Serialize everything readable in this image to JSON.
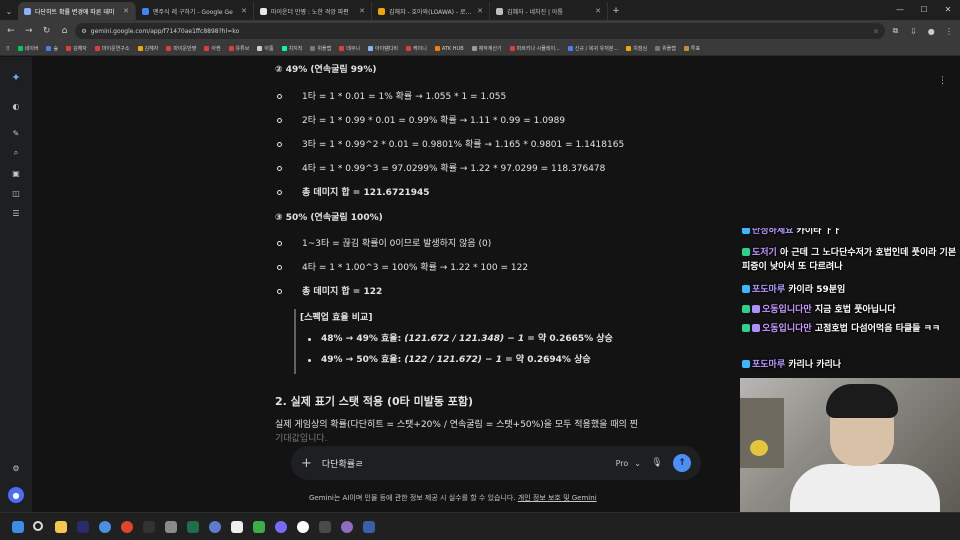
{
  "browser": {
    "tabs": [
      {
        "title": "다단히트 확률 변경에 따른 데미",
        "active": true,
        "color": "#8ab4f8"
      },
      {
        "title": "맨주식 레 구하기 - Google Ge",
        "active": false,
        "color": "#4285f4"
      },
      {
        "title": "마이운더 만쨩 : 노한 격앙 파편",
        "active": false,
        "color": "#e8e8e8"
      },
      {
        "title": "김해쟈 - 호아와(LOAWA) - 로...",
        "active": false,
        "color": "#f2a600"
      },
      {
        "title": "김혜자 - 네차진 | 아툼",
        "active": false,
        "color": "#bfbfbf"
      }
    ],
    "url": "gemini.google.com/app/f71470ae1ffc8898?hl=ko",
    "bookmarks": [
      {
        "label": "네이버",
        "color": "#03c75a"
      },
      {
        "label": "숲",
        "color": "#4a7df5"
      },
      {
        "label": "김해자",
        "color": "#e03c3c"
      },
      {
        "label": "마이운연구소",
        "color": "#e03c3c"
      },
      {
        "label": "김혜자",
        "color": "#f2a600"
      },
      {
        "label": "마이운만쨩",
        "color": "#e03c3c"
      },
      {
        "label": "아켄",
        "color": "#e03c3c"
      },
      {
        "label": "유튜브",
        "color": "#e03c3c"
      },
      {
        "label": "아툼",
        "color": "#cccccc"
      },
      {
        "label": "치지직",
        "color": "#00ffa3"
      },
      {
        "label": "위플랩",
        "color": "#777777"
      },
      {
        "label": "데쿠니",
        "color": "#e03c3c"
      },
      {
        "label": "아이템디비",
        "color": "#8ab4f8"
      },
      {
        "label": "케이니",
        "color": "#e03c3c"
      },
      {
        "label": "ATK HUB",
        "color": "#ff7a00"
      },
      {
        "label": "제작계산기",
        "color": "#999999"
      },
      {
        "label": "마르키나 시뮬레이...",
        "color": "#e03c3c"
      },
      {
        "label": "신규 / 복귀 유저분...",
        "color": "#4a7df5"
      },
      {
        "label": "치점심",
        "color": "#f2a600"
      },
      {
        "label": "위플랩",
        "color": "#777777"
      },
      {
        "label": "투표",
        "color": "#c48f2e"
      }
    ]
  },
  "content": {
    "h_case2": "② 49% (연속굴림 99%)",
    "c2_l1": "1타 = 1 * 0.01 = 1% 확률 → 1.055 * 1 = 1.055",
    "c2_l2": "2타 = 1 * 0.99 * 0.01 = 0.99% 확률 → 1.11 * 0.99 = 1.0989",
    "c2_l3": "3타 = 1 * 0.99^2 * 0.01 = 0.9801% 확률 → 1.165 * 0.9801 = 1.1418165",
    "c2_l4": "4타 = 1 * 0.99^3 = 97.0299% 확률 → 1.22 * 97.0299 = 118.376478",
    "c2_total": "총 데미지 합 = 121.6721945",
    "h_case3": "③ 50% (연속굴림 100%)",
    "c3_l1": "1~3타 = 끊김 확률이 0이므로 발생하지 않음 (0)",
    "c3_l2": "4타 = 1 * 1.00^3 = 100% 확률 → 1.22 * 100 = 122",
    "c3_total": "총 데미지 합 = 122",
    "quote_title": "[스펙업 효율 비교]",
    "q1_pre": "48% → 49% 효율: ",
    "q1_formula": "(121.672 / 121.348) − 1",
    "q1_post": " = 약 0.2665% 상승",
    "q2_pre": "49% → 50% 효율: ",
    "q2_formula": "(122 / 121.672) − 1",
    "q2_post": " = 약 0.2694% 상승",
    "section2": "2. 실제 표기 스탯 적용 (0타 미발동 포함)",
    "para": "실제 게임상의 확률(다단히트 = 스탯+20% / 연속굴림 = 스탯+50%)을 모두 적용했을 때의 찐",
    "para2": "기대값입니다."
  },
  "prompt": {
    "input_value": "다단확률ㄹ",
    "model": "Pro",
    "disclaimer": "Gemini는 AI이며 인물 등에 관한 정보 제공 시 실수를 할 수 있습니다. ",
    "disclaimer_link": "개인 정보 보호 및 Gemini"
  },
  "stream_chat": [
    {
      "nick": "만정하세요",
      "text": "카이타 ㅏㅏ",
      "partial": true
    },
    {
      "nick": "도저기",
      "text": "아 근데 그 노다단수저가 호법인데 풋이라 기본 피증이 낮아서 또 다르려나"
    },
    {
      "nick": "포도마루",
      "text": "카이라 59분임"
    },
    {
      "nick": "오동입니다만",
      "text": "지금 호법 풋아닙니다"
    },
    {
      "nick": "오동입니다만",
      "text": "고점호법 다섬어먹음 타클들 ㅋㅋ"
    },
    {
      "nick": "포도마루",
      "text": "카리나 카리나"
    }
  ]
}
